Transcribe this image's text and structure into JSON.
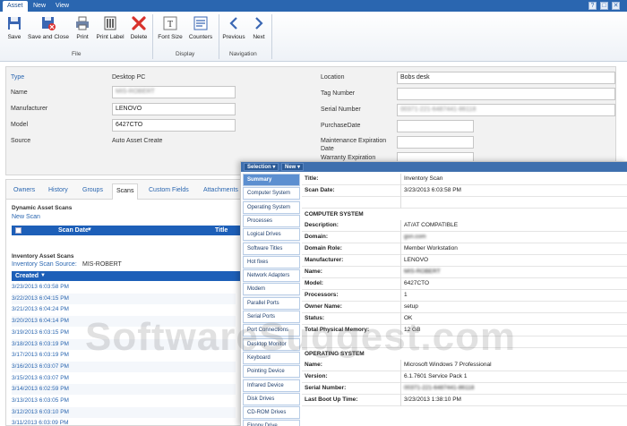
{
  "tabs": {
    "asset": "Asset",
    "new": "New",
    "view": "View"
  },
  "window_controls": [
    "?",
    "□",
    "✕"
  ],
  "ribbon": {
    "file_group": "File",
    "display_group": "Display",
    "navigation_group": "Navigation",
    "save": "Save",
    "save_close": "Save and Close",
    "print": "Print",
    "print_label": "Print Label",
    "delete": "Delete",
    "font_size": "Font Size",
    "counters": "Counters",
    "previous": "Previous",
    "next": "Next"
  },
  "form": {
    "type_label": "Type",
    "type_value": "Desktop PC",
    "name_label": "Name",
    "name_value": "MIS-ROBERT",
    "manufacturer_label": "Manufacturer",
    "manufacturer_value": "LENOVO",
    "model_label": "Model",
    "model_value": "6427CTO",
    "source_label": "Source",
    "source_value": "Auto Asset Create",
    "location_label": "Location",
    "location_value": "Bobs desk",
    "tag_label": "Tag Number",
    "tag_value": "",
    "serial_label": "Serial Number",
    "serial_value": "00371-221-6487441-86118",
    "purchase_label": "PurchaseDate",
    "purchase_value": "",
    "maint_label": "Maintenance Expiration Date",
    "maint_value": "",
    "warranty_label": "Warranty Expiration"
  },
  "lower_tabs": [
    "Owners",
    "History",
    "Groups",
    "Scans",
    "Custom Fields",
    "Attachments"
  ],
  "scans": {
    "dynamic_title": "Dynamic Asset Scans",
    "new_scan": "New Scan",
    "col_scan_date": "Scan Date",
    "col_title": "Title",
    "inventory_title": "Inventory Asset Scans",
    "inventory_source_label": "Inventory Scan Source:",
    "inventory_source": "MIS-ROBERT",
    "col_created": "Created",
    "rows": [
      "3/23/2013 6:03:58 PM",
      "3/22/2013 6:04:15 PM",
      "3/21/2013 6:04:24 PM",
      "3/20/2013 6:04:14 PM",
      "3/19/2013 6:03:15 PM",
      "3/18/2013 6:03:19 PM",
      "3/17/2013 6:03:19 PM",
      "3/16/2013 6:03:07 PM",
      "3/15/2013 6:03:07 PM",
      "3/14/2013 6:02:59 PM",
      "3/13/2013 6:03:05 PM",
      "3/12/2013 6:03:10 PM",
      "3/11/2013 6:03:09 PM"
    ]
  },
  "panel": {
    "selection": "Selection",
    "new": "New",
    "menu": [
      "Summary",
      "Computer System",
      "Operating System",
      "Processes",
      "Logical Drives",
      "Software Titles",
      "Hot fixes",
      "Network Adapters",
      "Modem",
      "Parallel Ports",
      "Serial Ports",
      "Port Connections",
      "Desktop Monitor",
      "Keyboard",
      "Pointing Device",
      "Infrared Device",
      "Disk Drives",
      "CD-ROM Drives",
      "Floppy Drive"
    ],
    "details": [
      {
        "k": "Title:",
        "v": "Inventory Scan"
      },
      {
        "k": "Scan Date:",
        "v": "3/23/2013 6:03:58 PM"
      },
      {
        "k": "",
        "v": ""
      },
      {
        "section": "COMPUTER SYSTEM"
      },
      {
        "k": "Description:",
        "v": "AT/AT COMPATIBLE"
      },
      {
        "k": "Domain:",
        "v": "gsn.com",
        "blur": true
      },
      {
        "k": "Domain Role:",
        "v": "Member Workstation"
      },
      {
        "k": "Manufacturer:",
        "v": "LENOVO"
      },
      {
        "k": "Name:",
        "v": "MIS-ROBERT",
        "blur": true
      },
      {
        "k": "Model:",
        "v": "6427CTO"
      },
      {
        "k": "Processors:",
        "v": "1"
      },
      {
        "k": "Owner Name:",
        "v": "setup"
      },
      {
        "k": "Status:",
        "v": "OK"
      },
      {
        "k": "Total Physical Memory:",
        "v": "12 GB"
      },
      {
        "k": "",
        "v": ""
      },
      {
        "section": "OPERATING SYSTEM"
      },
      {
        "k": "Name:",
        "v": "Microsoft Windows 7 Professional"
      },
      {
        "k": "Version:",
        "v": "6.1.7601 Service Pack 1"
      },
      {
        "k": "Serial Number:",
        "v": "00371-221-6487441-86118",
        "blur": true
      },
      {
        "k": "Last Boot Up Time:",
        "v": "3/23/2013 1:38:10 PM"
      }
    ]
  },
  "watermark": "SoftwareSuggest.com"
}
